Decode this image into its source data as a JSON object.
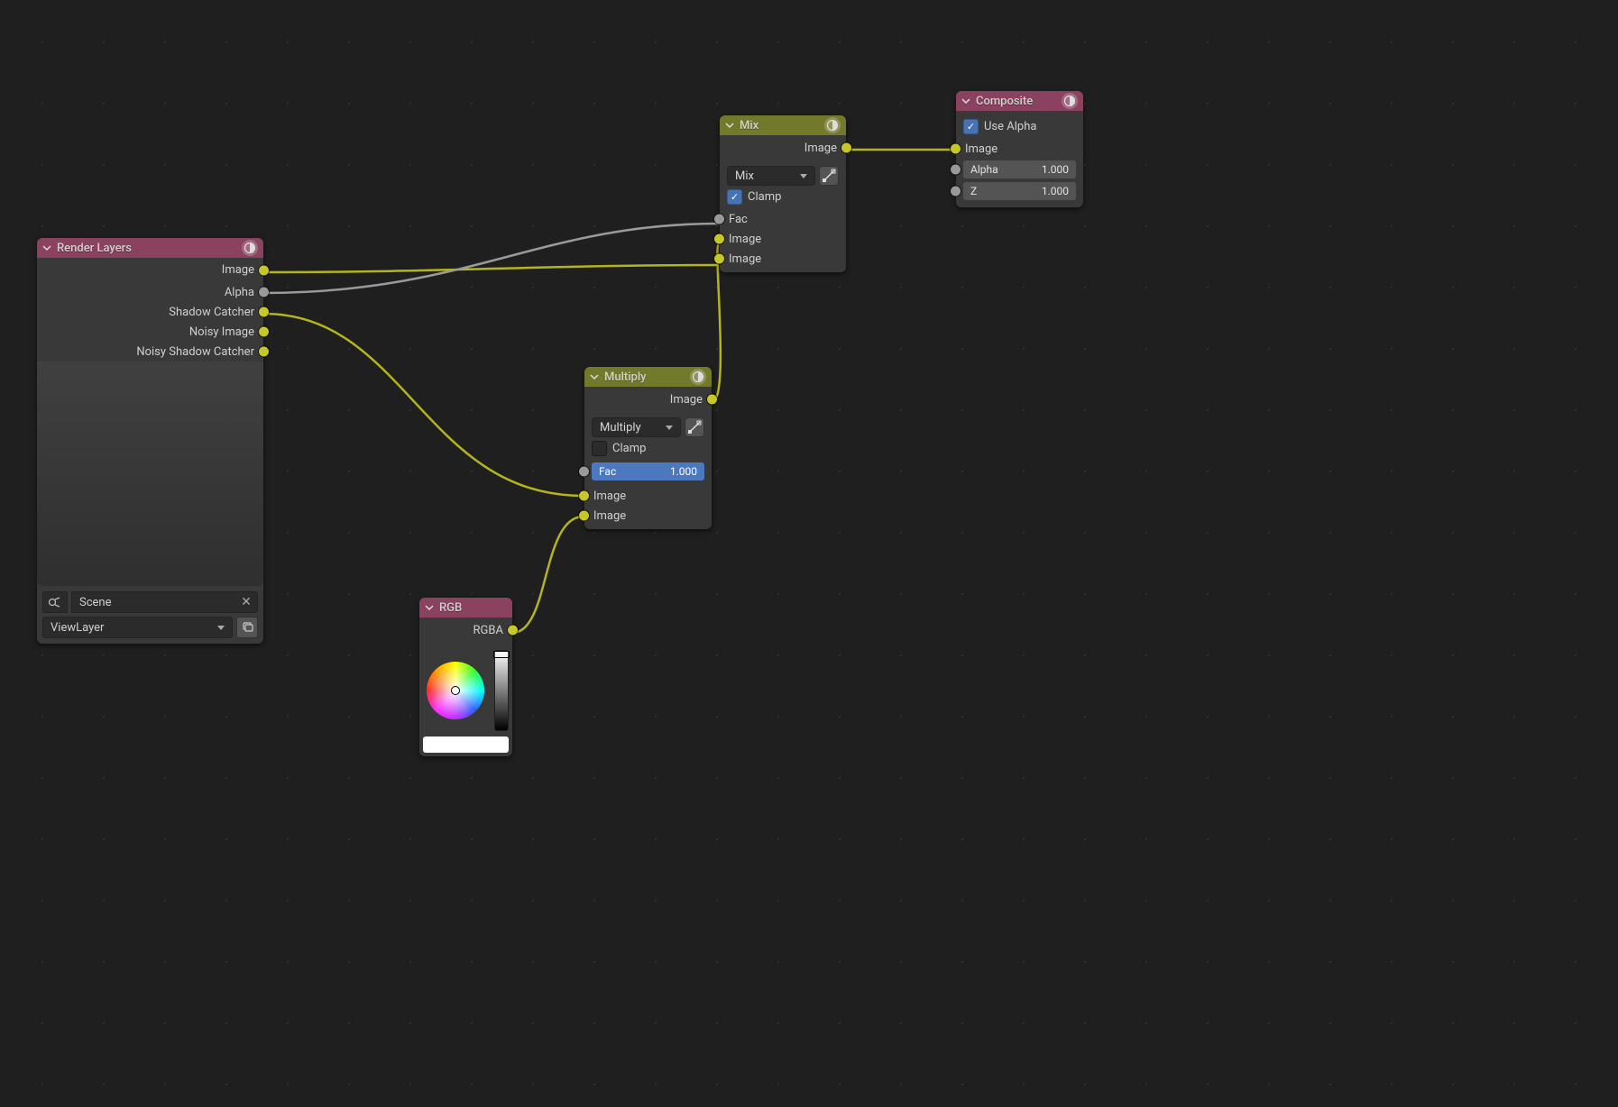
{
  "nodes": {
    "renderLayers": {
      "title": "Render Layers",
      "outputs": [
        "Image",
        "Alpha",
        "Shadow Catcher",
        "Noisy Image",
        "Noisy Shadow Catcher"
      ],
      "scene": "Scene",
      "viewLayer": "ViewLayer"
    },
    "mix": {
      "title": "Mix",
      "outImage": "Image",
      "blend": "Mix",
      "clamp": "Clamp",
      "clampOn": true,
      "fac": "Fac",
      "in1": "Image",
      "in2": "Image"
    },
    "multiply": {
      "title": "Multiply",
      "outImage": "Image",
      "blend": "Multiply",
      "clamp": "Clamp",
      "clampOn": false,
      "facLabel": "Fac",
      "facValue": "1.000",
      "in1": "Image",
      "in2": "Image"
    },
    "rgb": {
      "title": "RGB",
      "out": "RGBA"
    },
    "composite": {
      "title": "Composite",
      "useAlpha": "Use Alpha",
      "useAlphaOn": true,
      "inImage": "Image",
      "alphaLabel": "Alpha",
      "alphaValue": "1.000",
      "zLabel": "Z",
      "zValue": "1.000"
    }
  }
}
